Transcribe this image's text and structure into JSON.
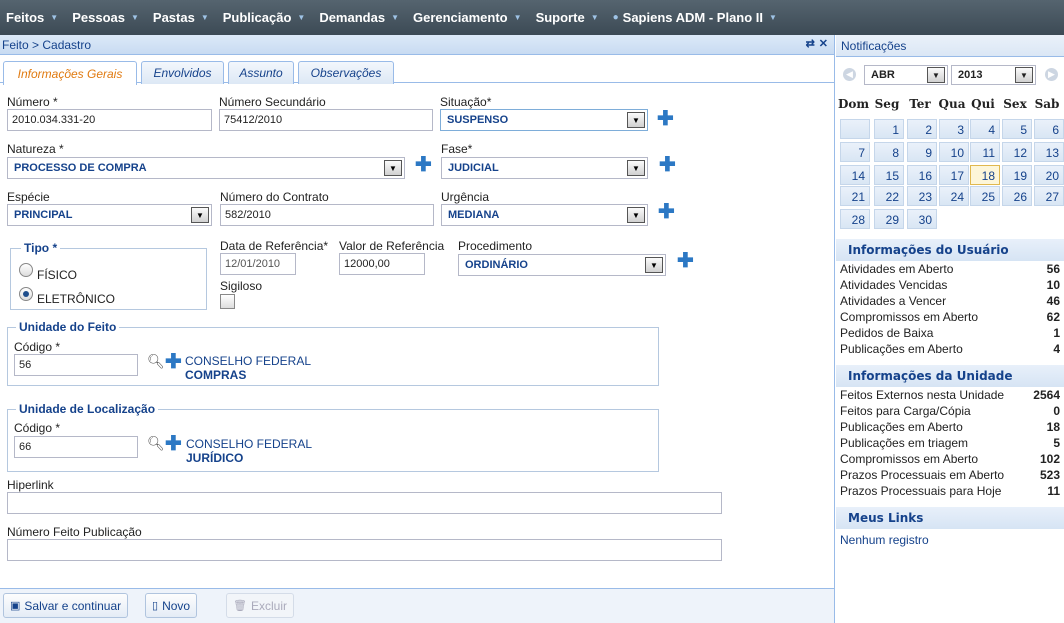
{
  "menu": [
    {
      "label": "Feitos"
    },
    {
      "label": "Pessoas"
    },
    {
      "label": "Pastas"
    },
    {
      "label": "Publicação"
    },
    {
      "label": "Demandas"
    },
    {
      "label": "Gerenciamento"
    },
    {
      "label": "Suporte"
    },
    {
      "label": "Sapiens ADM - Plano II"
    }
  ],
  "panel": {
    "title": "Feito > Cadastro"
  },
  "tabs": [
    "Informações Gerais",
    "Envolvidos",
    "Assunto",
    "Observações"
  ],
  "form": {
    "numero": {
      "label": "Número *",
      "value": "2010.034.331-20"
    },
    "numero_secundario": {
      "label": "Número Secundário",
      "value": "75412/2010"
    },
    "situacao": {
      "label": "Situação*",
      "value": "SUSPENSO"
    },
    "natureza": {
      "label": "Natureza *",
      "value": "PROCESSO DE COMPRA"
    },
    "fase": {
      "label": "Fase*",
      "value": "JUDICIAL"
    },
    "especie": {
      "label": "Espécie",
      "value": "PRINCIPAL"
    },
    "numero_contrato": {
      "label": "Número do Contrato",
      "value": "582/2010"
    },
    "urgencia": {
      "label": "Urgência",
      "value": "MEDIANA"
    },
    "tipo": {
      "legend": "Tipo *",
      "options": [
        "FÍSICO",
        "ELETRÔNICO"
      ],
      "selected": "ELETRÔNICO"
    },
    "data_referencia": {
      "label": "Data de Referência*",
      "value": "12/01/2010"
    },
    "valor_referencia": {
      "label": "Valor de Referência",
      "value": "12000,00"
    },
    "procedimento": {
      "label": "Procedimento",
      "value": "ORDINÁRIO"
    },
    "sigiloso": {
      "label": "Sigiloso",
      "checked": false
    },
    "unidade_feito": {
      "legend": "Unidade do Feito",
      "codigo_label": "Código *",
      "codigo": "56",
      "org": "CONSELHO FEDERAL",
      "unit": "COMPRAS"
    },
    "unidade_localizacao": {
      "legend": "Unidade de Localização",
      "codigo_label": "Código *",
      "codigo": "66",
      "org": "CONSELHO FEDERAL",
      "unit": "JURÍDICO"
    },
    "hiperlink": {
      "label": "Hiperlink",
      "value": ""
    },
    "numero_feito_publicacao": {
      "label": "Número Feito Publicação",
      "value": ""
    }
  },
  "footer": {
    "save": "Salvar e continuar",
    "new": "Novo",
    "delete": "Excluir"
  },
  "notifications": {
    "title": "Notificações",
    "calendar": {
      "month": "ABR",
      "year": "2013",
      "weekdays": [
        "Dom",
        "Seg",
        "Ter",
        "Qua",
        "Qui",
        "Sex",
        "Sab"
      ],
      "today": 18,
      "days_in_month": 30,
      "first_weekday": 1
    },
    "user_info": {
      "title": "Informações do Usuário",
      "rows": [
        {
          "label": "Atividades em Aberto",
          "value": "56"
        },
        {
          "label": "Atividades Vencidas",
          "value": "10"
        },
        {
          "label": "Atividades a Vencer",
          "value": "46"
        },
        {
          "label": "Compromissos em Aberto",
          "value": "62"
        },
        {
          "label": "Pedidos de Baixa",
          "value": "1"
        },
        {
          "label": "Publicações em Aberto",
          "value": "4"
        }
      ]
    },
    "unit_info": {
      "title": "Informações da Unidade",
      "rows": [
        {
          "label": "Feitos Externos nesta Unidade",
          "value": "2564"
        },
        {
          "label": "Feitos para Carga/Cópia",
          "value": "0"
        },
        {
          "label": "Publicações em Aberto",
          "value": "18"
        },
        {
          "label": "Publicações em triagem",
          "value": "5"
        },
        {
          "label": "Compromissos em Aberto",
          "value": "102"
        },
        {
          "label": "Prazos Processuais em Aberto",
          "value": "523"
        },
        {
          "label": "Prazos Processuais para Hoje",
          "value": "11"
        }
      ]
    },
    "links": {
      "title": "Meus Links",
      "empty": "Nenhum registro"
    }
  }
}
